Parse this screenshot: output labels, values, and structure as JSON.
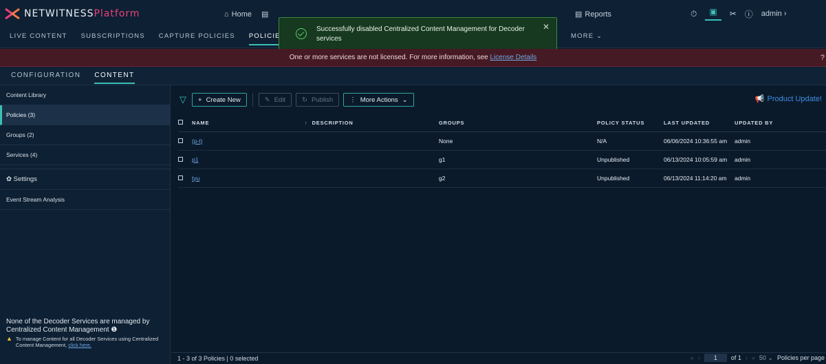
{
  "app": {
    "logo_main": "NETWITNESS",
    "logo_accent": "Platform"
  },
  "topnav": [
    {
      "icon": "home-icon",
      "label": "Home"
    },
    {
      "icon": "document-icon",
      "label": ""
    }
  ],
  "reports": {
    "label": "Reports"
  },
  "user": {
    "label": "admin"
  },
  "subnav": {
    "items": [
      "LIVE CONTENT",
      "SUBSCRIPTIONS",
      "CAPTURE POLICIES",
      "POLICIES",
      "E"
    ],
    "more": "MORE"
  },
  "toast": {
    "message": "Successfully disabled Centralized Content Management for Decoder services",
    "close": "✕"
  },
  "banner": {
    "text": "One or more services are not licensed. For more information, see",
    "link": "License Details",
    "help": "?"
  },
  "config_tabs": [
    "CONFIGURATION",
    "CONTENT"
  ],
  "sidebar": {
    "items": [
      "Content Library",
      "Policies (3)",
      "Groups (2)",
      "Services (4)"
    ],
    "settings": "Settings",
    "event_stream": "Event Stream Analysis",
    "note_title": "None of the Decoder Services are managed by Centralized Content Management",
    "note_text": "To manage Content for all Decoder Services using Centralized Content Management,",
    "note_link": "click here."
  },
  "toolbar": {
    "create_new": "Create New",
    "edit": "Edit",
    "publish": "Publish",
    "more_actions": "More Actions",
    "product_update": "Product Update!"
  },
  "table": {
    "headers": [
      "NAME",
      "DESCRIPTION",
      "GROUPS",
      "POLICY STATUS",
      "LAST UPDATED",
      "UPDATED BY"
    ],
    "rows": [
      {
        "name": "(p-t)",
        "description": "",
        "groups": "None",
        "status": "N/A",
        "updated": "06/06/2024 10:36:55 am",
        "by": "admin"
      },
      {
        "name": "p1",
        "description": "",
        "groups": "g1",
        "status": "Unpublished",
        "updated": "06/13/2024 10:05:59 am",
        "by": "admin"
      },
      {
        "name": "tyu",
        "description": "",
        "groups": "g2",
        "status": "Unpublished",
        "updated": "06/13/2024 11:14:20 am",
        "by": "admin"
      }
    ]
  },
  "footer": {
    "summary": "1 - 3 of 3 Policies | 0 selected",
    "page": "1",
    "of": "of 1",
    "per_page_value": "50",
    "per_page_label": "Policies per page"
  }
}
